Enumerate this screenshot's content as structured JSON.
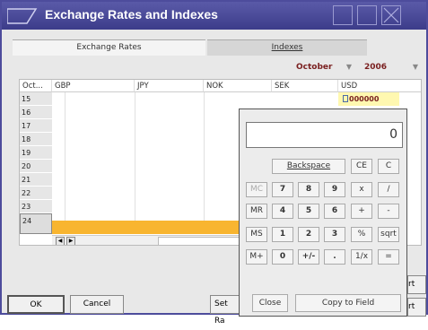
{
  "window": {
    "title": "Exchange Rates and Indexes"
  },
  "tabs": [
    {
      "label": "Exchange Rates"
    },
    {
      "label": "Indexes"
    }
  ],
  "period": {
    "month": "October",
    "year": "2006"
  },
  "grid": {
    "headers": [
      "Oct...",
      "GBP",
      "JPY",
      "NOK",
      "SEK",
      "USD"
    ],
    "rows": [
      "15",
      "16",
      "17",
      "18",
      "19",
      "20",
      "21",
      "22",
      "23",
      "24"
    ],
    "usd_value": "000000"
  },
  "footer": {
    "ok": "OK",
    "cancel": "Cancel",
    "set_rate": "Set Ra",
    "right_btn1": "rt",
    "right_btn2": "rt"
  },
  "calculator": {
    "display": "0",
    "backspace": "Backspace",
    "ce": "CE",
    "c": "C",
    "keys": [
      [
        "MC",
        "7",
        "8",
        "9",
        "x",
        "/"
      ],
      [
        "MR",
        "4",
        "5",
        "6",
        "+",
        "-"
      ],
      [
        "MS",
        "1",
        "2",
        "3",
        "%",
        "sqrt"
      ],
      [
        "M+",
        "0",
        "+/-",
        ".",
        "1/x",
        "="
      ]
    ],
    "close": "Close",
    "copy": "Copy to Field"
  }
}
